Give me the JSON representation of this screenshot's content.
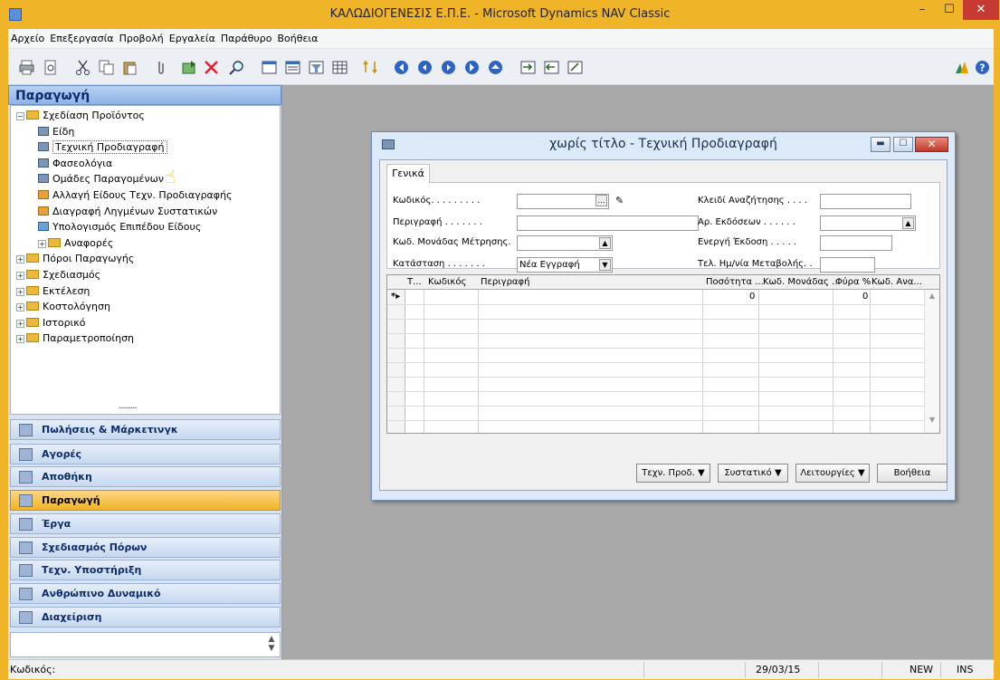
{
  "window": {
    "title": "ΚΑΛΩΔΙΟΓΕΝΕΣΙΣ Ε.Π.Ε. - Microsoft Dynamics NAV Classic",
    "min": "–",
    "max": "☐",
    "close": "✕"
  },
  "menu": [
    "Αρχείο",
    "Επεξεργασία",
    "Προβολή",
    "Εργαλεία",
    "Παράθυρο",
    "Βοήθεια"
  ],
  "toolbar_icons": [
    "print-icon",
    "print-preview-icon",
    "cut-icon",
    "copy-icon",
    "paste-icon",
    "attach-icon",
    "new-record-icon",
    "delete-icon",
    "find-icon",
    "list-icon",
    "card-icon",
    "filter-icon",
    "table-icon",
    "sort-icon",
    "first-icon",
    "previous-icon",
    "next-icon",
    "last-icon",
    "up-icon",
    "import-icon",
    "export-icon",
    "link-icon",
    "dynamics-logo-icon",
    "help-icon"
  ],
  "nav": {
    "header": "Παραγωγή",
    "tree": [
      {
        "label": "Σχεδίαση Προϊόντος",
        "level": 0,
        "type": "folder",
        "expand": "−"
      },
      {
        "label": "Είδη",
        "level": 1,
        "type": "doc"
      },
      {
        "label": "Τεχνική Προδιαγραφή",
        "level": 1,
        "type": "doc",
        "selected": true
      },
      {
        "label": "Φασεολόγια",
        "level": 1,
        "type": "doc"
      },
      {
        "label": "Ομάδες Παραγομένων",
        "level": 1,
        "type": "doc"
      },
      {
        "label": "Αλλαγή Είδους Τεχν. Προδιαγραφής",
        "level": 1,
        "type": "task"
      },
      {
        "label": "Διαγραφή Ληγμένων Συστατικών",
        "level": 1,
        "type": "task"
      },
      {
        "label": "Υπολογισμός Επιπέδου Είδους",
        "level": 1,
        "type": "calc"
      },
      {
        "label": "Αναφορές",
        "level": 1,
        "type": "folder",
        "expand": "+"
      },
      {
        "label": "Πόροι Παραγωγής",
        "level": 0,
        "type": "folder",
        "expand": "+"
      },
      {
        "label": "Σχεδιασμός",
        "level": 0,
        "type": "folder",
        "expand": "+"
      },
      {
        "label": "Εκτέλεση",
        "level": 0,
        "type": "folder",
        "expand": "+"
      },
      {
        "label": "Κοστολόγηση",
        "level": 0,
        "type": "folder",
        "expand": "+"
      },
      {
        "label": "Ιστορικό",
        "level": 0,
        "type": "folder",
        "expand": "+"
      },
      {
        "label": "Παραμετροποίηση",
        "level": 0,
        "type": "folder",
        "expand": "+"
      }
    ],
    "modules": [
      "Πωλήσεις & Μάρκετινγκ",
      "Αγορές",
      "Αποθήκη",
      "Παραγωγή",
      "Έργα",
      "Σχεδιασμός Πόρων",
      "Τεχν. Υποστήριξη",
      "Ανθρώπινο Δυναμικό",
      "Διαχείριση"
    ],
    "active_module": "Παραγωγή"
  },
  "form": {
    "title": "χωρίς τίτλο - Τεχνική Προδιαγραφή",
    "tab": "Γενικά",
    "fields": {
      "code_label": "Κωδικός. . . . . . . . .",
      "code_value": "",
      "desc_label": "Περιγραφή . . . . . . .",
      "desc_value": "",
      "uom_label": "Κωδ. Μονάδας Μέτρησης.",
      "uom_value": "",
      "status_label": "Κατάσταση . . . . . . .",
      "status_value": "Νέα Εγγραφή",
      "search_label": "Κλειδί Αναζήτησης . . . .",
      "search_value": "",
      "versions_label": "Αρ. Εκδόσεων . . . . . .",
      "versions_value": "",
      "active_label": "Ενεργή Έκδοση . . . . .",
      "active_value": "",
      "lastmod_label": "Τελ. Ημ/νία Μεταβολής. .",
      "lastmod_value": ""
    },
    "grid": {
      "columns": [
        "Τ...",
        "Κωδικός",
        "Περιγραφή",
        "Ποσότητα ...",
        "Κωδ. Μονάδας ...",
        "Φύρα %",
        "Κωδ. Ανα..."
      ],
      "rows": [
        {
          "marker": "*▸",
          "qty": "0",
          "scrap": "0"
        }
      ]
    },
    "buttons": [
      "Τεχν. Προδ. ▼",
      "Συστατικό ▼",
      "Λειτουργίες ▼",
      "Βοήθεια"
    ]
  },
  "status": {
    "field": "Κωδικός:",
    "date": "29/03/15",
    "mode1": "NEW",
    "mode2": "INS"
  }
}
